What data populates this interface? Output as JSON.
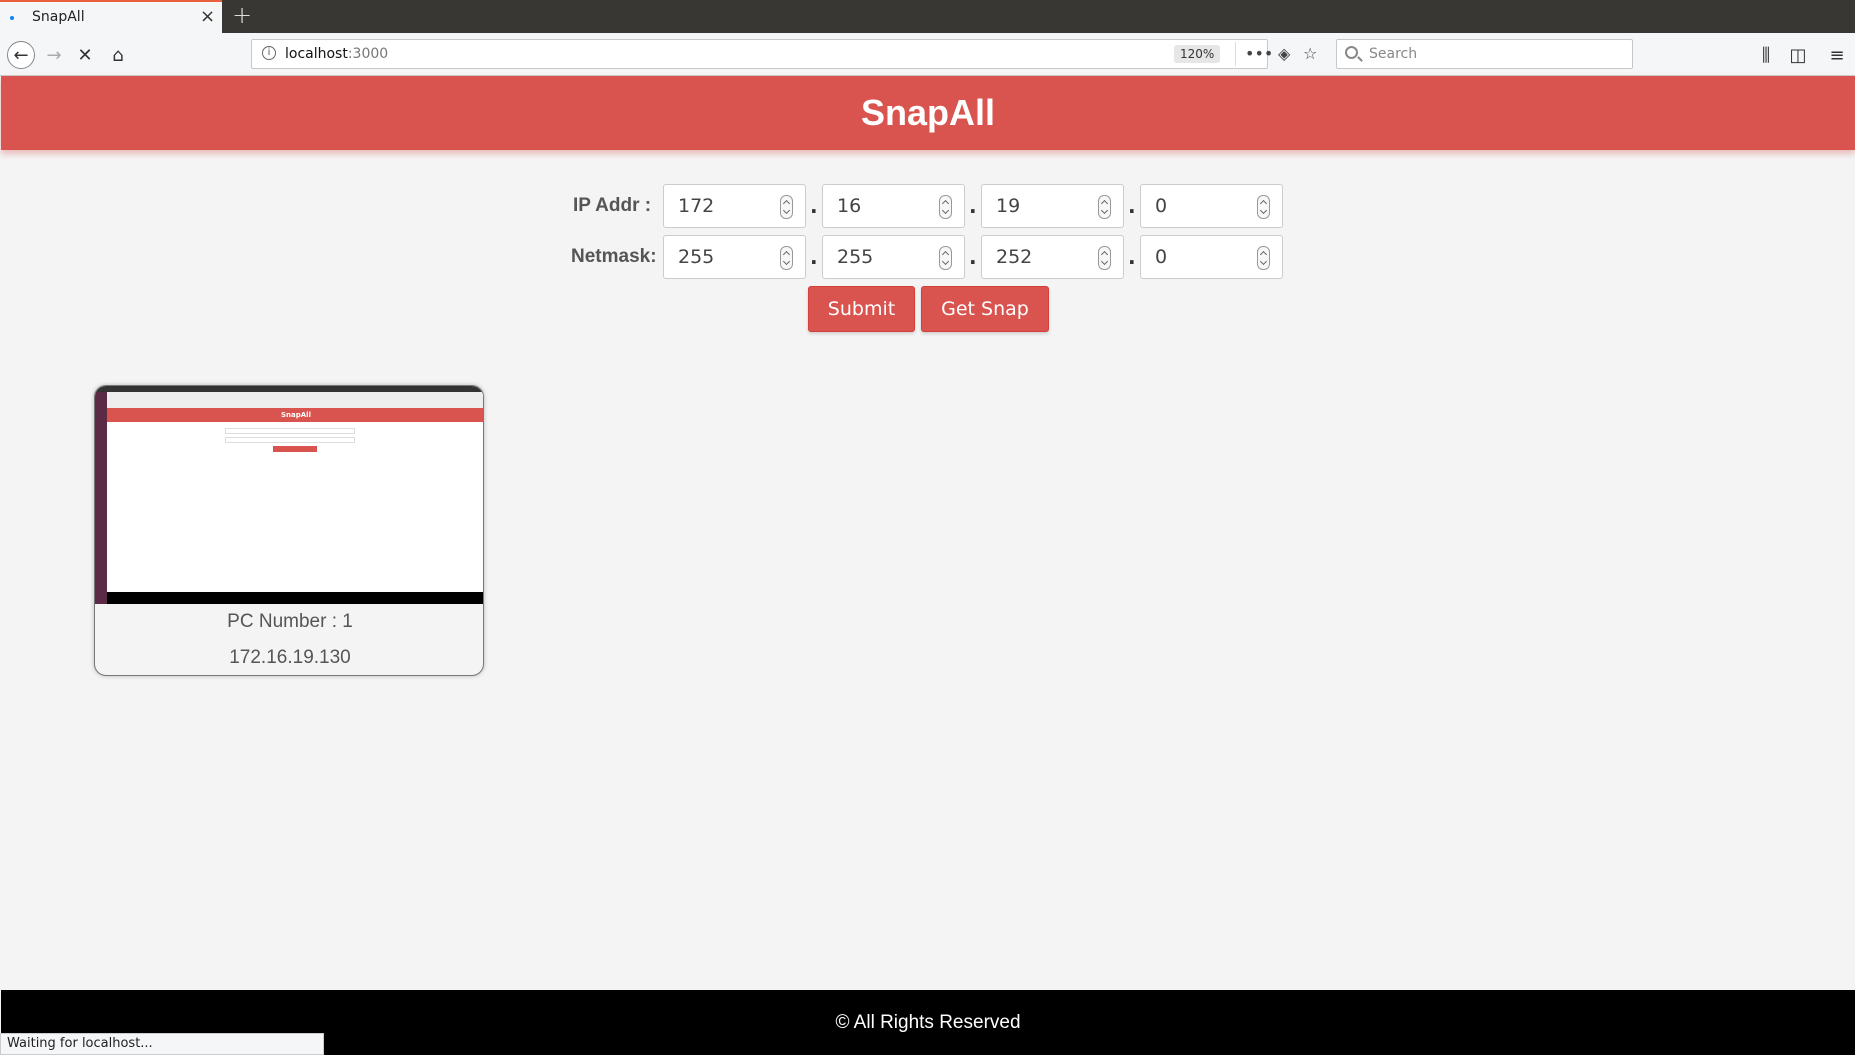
{
  "browser": {
    "tab_title": "SnapAll",
    "url_host": "localhost",
    "url_port": ":3000",
    "zoom": "120%",
    "search_placeholder": "Search",
    "status": "Waiting for localhost..."
  },
  "app": {
    "title": "SnapAll"
  },
  "form": {
    "ip_label": "IP Addr :",
    "netmask_label": "Netmask:",
    "ip": [
      "172",
      "16",
      "19",
      "0"
    ],
    "netmask": [
      "255",
      "255",
      "252",
      "0"
    ],
    "separator": ".",
    "submit_label": "Submit",
    "get_snap_label": "Get Snap"
  },
  "cards": [
    {
      "pc_label": "PC Number : 1",
      "ip": "172.16.19.130",
      "thumb_title": "SnapAll"
    }
  ],
  "footer": {
    "text": "© All Rights Reserved"
  },
  "colors": {
    "accent": "#d9534f",
    "background": "#f4f4f4",
    "footer": "#000000"
  }
}
